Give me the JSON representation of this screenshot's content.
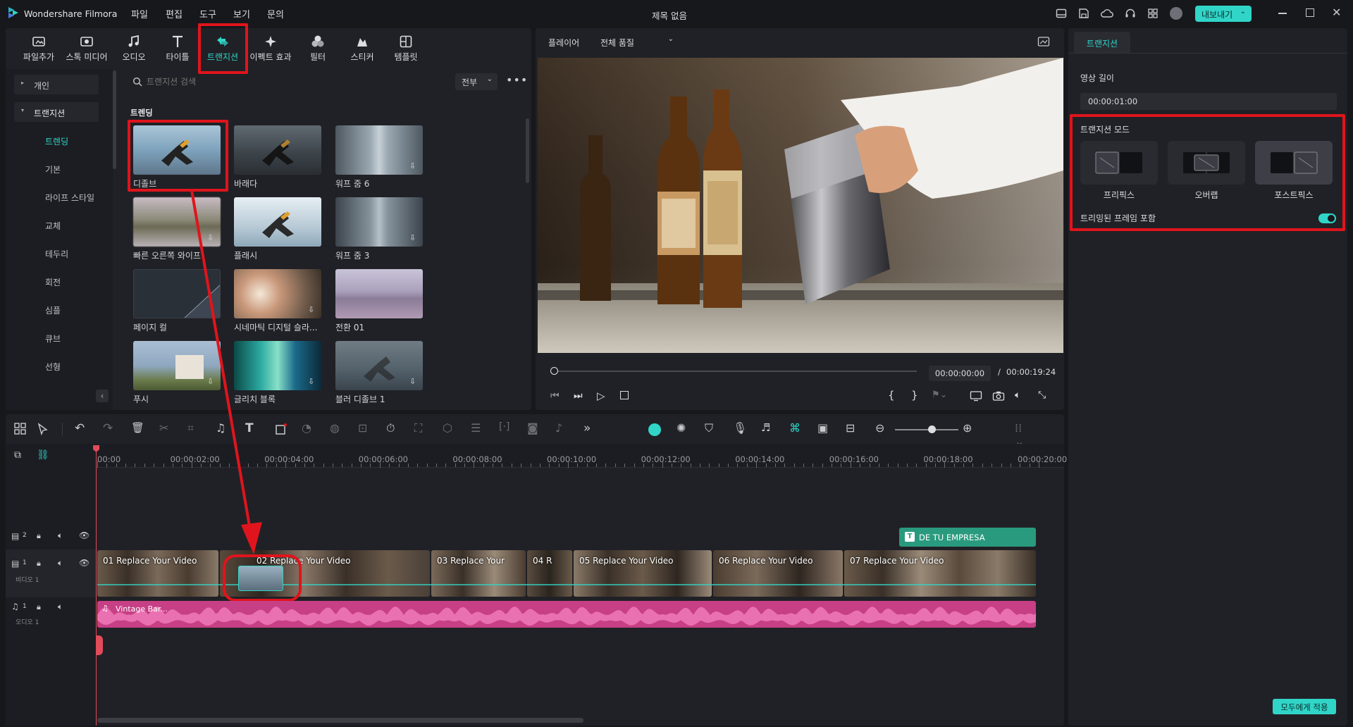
{
  "app": {
    "name": "Wondershare Filmora",
    "title": "제목 없음",
    "export_label": "내보내기"
  },
  "menu": [
    "파일",
    "편집",
    "도구",
    "보기",
    "문의"
  ],
  "toolbar_tabs": [
    {
      "label": "파일추가",
      "icon": "import-icon"
    },
    {
      "label": "스톡 미디어",
      "icon": "stock-media-icon"
    },
    {
      "label": "오디오",
      "icon": "music-note-icon"
    },
    {
      "label": "타이틀",
      "icon": "title-t-icon"
    },
    {
      "label": "트랜지션",
      "icon": "transition-icon"
    },
    {
      "label": "이펙트 효과",
      "icon": "effects-sparkle-icon"
    },
    {
      "label": "필터",
      "icon": "filter-icon"
    },
    {
      "label": "스티커",
      "icon": "sticker-icon"
    },
    {
      "label": "템플릿",
      "icon": "template-icon"
    }
  ],
  "sidebar": {
    "groups": [
      "개인",
      "트랜지션"
    ],
    "items": [
      "트렌딩",
      "기본",
      "라이프 스타일",
      "교체",
      "테두리",
      "회전",
      "심플",
      "큐브",
      "선형"
    ]
  },
  "library": {
    "search_placeholder": "트랜지션 검색",
    "filter_value": "전부",
    "section_title": "트렌딩",
    "items": [
      {
        "label": "디졸브"
      },
      {
        "label": "바래다"
      },
      {
        "label": "워프 줌 6"
      },
      {
        "label": "빠른 오른쪽 와이프"
      },
      {
        "label": "플래시"
      },
      {
        "label": "워프 줌 3"
      },
      {
        "label": "페이지 컬"
      },
      {
        "label": "시네마틱 디지털 슬라..."
      },
      {
        "label": "전환 01"
      },
      {
        "label": "푸시"
      },
      {
        "label": "글리치 블록"
      },
      {
        "label": "블러 디졸브 1"
      }
    ]
  },
  "player": {
    "label": "플레이어",
    "quality": "전체 품질",
    "current_time": "00:00:00:00",
    "separator": "/",
    "total_time": "00:00:19:24",
    "progress": 0.0
  },
  "properties": {
    "tab": "트랜지션",
    "duration_label": "영상 길이",
    "duration_value": "00:00:01:00",
    "mode_label": "트랜지션 모드",
    "modes": [
      "프리픽스",
      "오버랩",
      "포스트픽스"
    ],
    "selected_mode": "포스트픽스",
    "trim_label": "트리밍된 프레임 포함",
    "trim_enabled": true,
    "apply_all": "모두에게 적용"
  },
  "timeline": {
    "ruler": [
      "00:00",
      "00:00:02:00",
      "00:00:04:00",
      "00:00:06:00",
      "00:00:08:00",
      "00:00:10:00",
      "00:00:12:00",
      "00:00:14:00",
      "00:00:16:00",
      "00:00:18:00",
      "00:00:20:00"
    ],
    "tracks": [
      {
        "num": "2",
        "label": ""
      },
      {
        "num": "1",
        "label": "비디오 1"
      },
      {
        "num": "1",
        "label": "오디오 1"
      }
    ],
    "title_clip": "DE TU EMPRESA",
    "video_clips": [
      "01 Replace Your Video",
      "02 Replace Your Video",
      "03 Replace Your",
      "04 R",
      "05 Replace Your Video",
      "06 Replace Your Video",
      "07 Replace Your Video"
    ],
    "audio_clip": "Vintage Bar..."
  },
  "colors": {
    "accent": "#30d5c8",
    "highlight": "#e0141c",
    "audio": "#d6478f",
    "background": "#17181c",
    "panel": "#202126"
  }
}
